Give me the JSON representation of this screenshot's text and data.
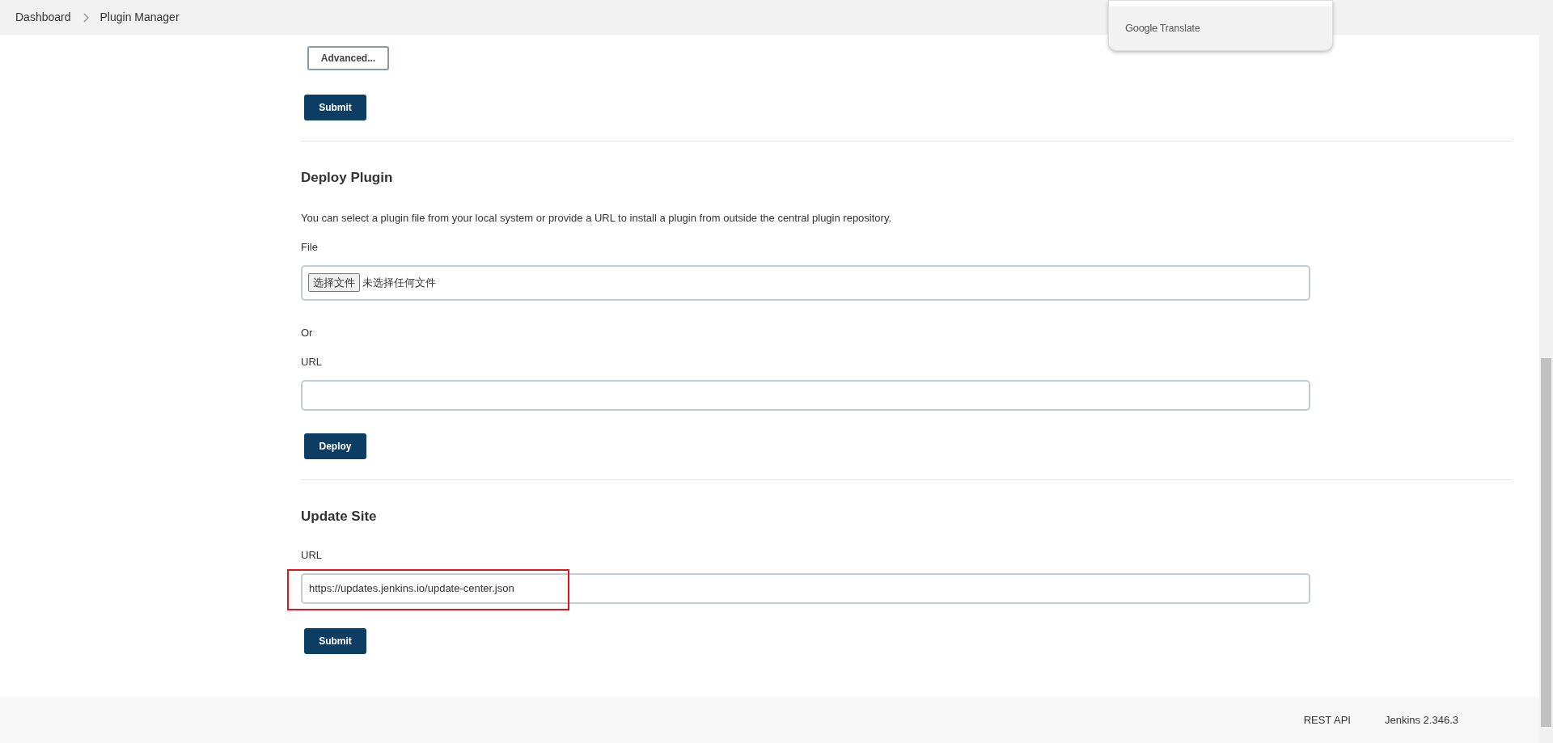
{
  "breadcrumbs": [
    "Dashboard",
    "Plugin Manager"
  ],
  "translate_popup": {
    "label_brand": "Google",
    "label": "Translate"
  },
  "advanced_section": {
    "advanced_button": "Advanced...",
    "submit_button": "Submit"
  },
  "deploy_plugin": {
    "title": "Deploy Plugin",
    "description": "You can select a plugin file from your local system or provide a URL to install a plugin from outside the central plugin repository.",
    "file_label": "File",
    "file_button": "选择文件",
    "file_status": "未选择任何文件",
    "or_text": "Or",
    "url_label": "URL",
    "deploy_button": "Deploy"
  },
  "update_site": {
    "title": "Update Site",
    "url_label": "URL",
    "url_value": "https://updates.jenkins.io/update-center.json",
    "highlighted": true,
    "submit_button": "Submit"
  },
  "footer": {
    "links": [
      "REST API",
      "Jenkins 2.346.3"
    ]
  }
}
